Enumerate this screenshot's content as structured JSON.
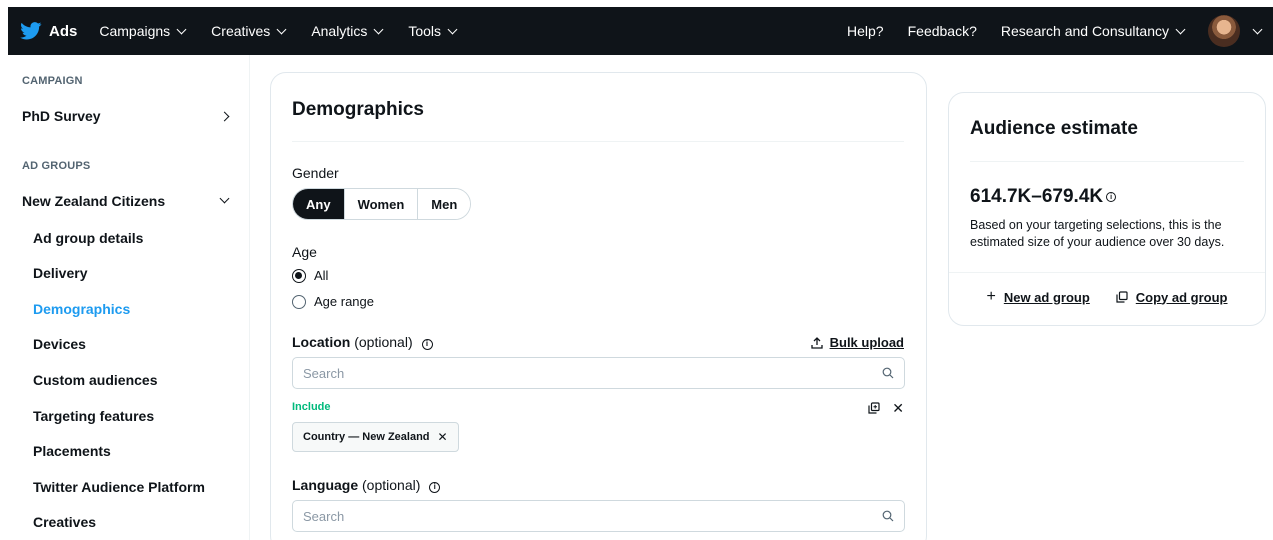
{
  "topbar": {
    "brand": "Ads",
    "nav": [
      "Campaigns",
      "Creatives",
      "Analytics",
      "Tools"
    ],
    "help": "Help?",
    "feedback": "Feedback?",
    "account": "Research and Consultancy"
  },
  "sidebar": {
    "campaign_label": "CAMPAIGN",
    "campaign_name": "PhD Survey",
    "ad_groups_label": "AD GROUPS",
    "ad_group_name": "New Zealand Citizens",
    "items": [
      "Ad group details",
      "Delivery",
      "Demographics",
      "Devices",
      "Custom audiences",
      "Targeting features",
      "Placements",
      "Twitter Audience Platform",
      "Creatives"
    ],
    "active_item": "Demographics"
  },
  "demographics": {
    "title": "Demographics",
    "gender_label": "Gender",
    "gender_options": [
      "Any",
      "Women",
      "Men"
    ],
    "gender_selected": "Any",
    "age_label": "Age",
    "age_options": [
      "All",
      "Age range"
    ],
    "age_selected": "All",
    "location_label": "Location",
    "location_optional": "(optional)",
    "bulk_upload": "Bulk upload",
    "location_placeholder": "Search",
    "include_label": "Include",
    "location_chip": "Country — New Zealand",
    "language_label": "Language",
    "language_optional": "(optional)",
    "language_placeholder": "Search"
  },
  "audience": {
    "title": "Audience estimate",
    "range": "614.7K–679.4K",
    "description": "Based on your targeting selections, this is the estimated size of your audience over 30 days.",
    "new_ad_group": "New ad group",
    "copy_ad_group": "Copy ad group"
  },
  "icons": {
    "brand": "twitter-bird-icon",
    "search": "search-icon",
    "upload": "upload-icon",
    "info": "info-icon",
    "copy": "copy-icon",
    "close": "close-icon"
  },
  "colors": {
    "topbar": "#0f1419",
    "accent": "#1d9bf0",
    "include": "#00ba7c"
  }
}
